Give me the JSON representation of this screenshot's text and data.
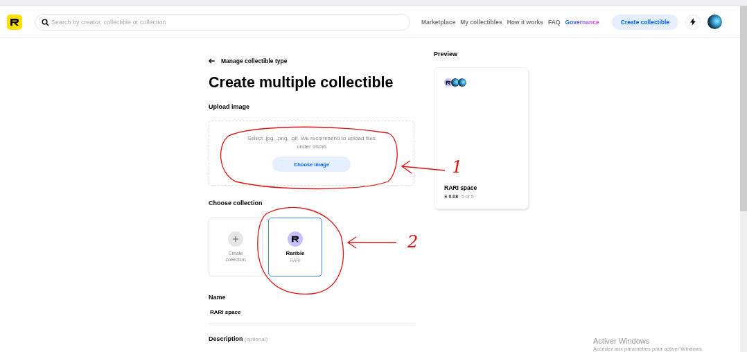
{
  "header": {
    "search": {
      "placeholder": "Search by creator, collectible or collection"
    },
    "nav": [
      {
        "label": "Marketplace",
        "kind": "plain"
      },
      {
        "label": "My collectibles",
        "kind": "plain"
      },
      {
        "label": "How it works",
        "kind": "plain"
      },
      {
        "label": "FAQ",
        "kind": "plain"
      },
      {
        "label": "Governance",
        "kind": "gradient"
      }
    ],
    "create_button": "Create collectible"
  },
  "back_link": "Manage collectible type",
  "title": "Create multiple collectible",
  "upload": {
    "heading": "Upload image",
    "hint": "Select .jpg, .png, .gif. We recommend to upload files under 10mb",
    "button": "Choose image"
  },
  "collection": {
    "heading": "Choose collection",
    "options": [
      {
        "kind": "create",
        "label": "Create collection",
        "selected": false
      },
      {
        "kind": "existing",
        "name": "Rarible",
        "symbol": "RARI",
        "selected": true
      }
    ]
  },
  "name": {
    "label": "Name",
    "value": "RARI space"
  },
  "description": {
    "label": "Description",
    "note": "(optional)"
  },
  "preview": {
    "heading": "Preview",
    "name": "RARI space",
    "price": "Ξ 0.08",
    "supply": "5 of 5"
  },
  "annotations": [
    {
      "label": "1"
    },
    {
      "label": "2"
    }
  ],
  "os_notice": {
    "title": "Activer Windows",
    "text": "Accédez aux paramètres pour activer Windows."
  }
}
